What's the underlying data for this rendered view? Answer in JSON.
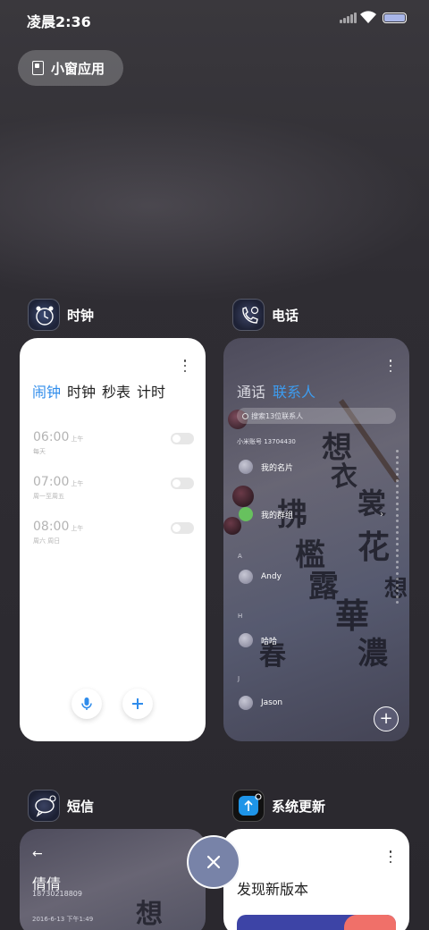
{
  "status_bar": {
    "time": "凌晨2:36",
    "battery_color": "#a9b6e8"
  },
  "small_window": {
    "label": "小窗应用"
  },
  "apps": {
    "clock": {
      "name": "时钟",
      "tabs": [
        "闹钟",
        "时钟",
        "秒表",
        "计时"
      ],
      "active_tab": 0,
      "alarms": [
        {
          "time": "06:00",
          "ampm": "上午",
          "repeat": "每天",
          "enabled": false
        },
        {
          "time": "07:00",
          "ampm": "上午",
          "repeat": "周一至周五",
          "enabled": false
        },
        {
          "time": "08:00",
          "ampm": "上午",
          "repeat": "周六 周日",
          "enabled": false
        }
      ],
      "accent": "#2f8ceb"
    },
    "phone": {
      "name": "电话",
      "tabs": [
        "通话",
        "联系人"
      ],
      "active_tab": 1,
      "search_placeholder": "搜索13位联系人",
      "account": "小米账号 13704430",
      "contacts": [
        {
          "name": "我的名片"
        },
        {
          "name": "我的群组"
        },
        {
          "name": "Andy"
        },
        {
          "name": "哈哈"
        },
        {
          "name": "Jason"
        }
      ],
      "sections": [
        "A",
        "H",
        "J"
      ],
      "accent": "#3d9cf0"
    },
    "sms": {
      "name": "短信",
      "contact_name": "倩倩",
      "number": "18730218809",
      "date": "2016-6-13 下午1:49"
    },
    "update": {
      "name": "系统更新",
      "title": "发现新版本"
    }
  },
  "close_all": {
    "color": "#7883a8"
  }
}
